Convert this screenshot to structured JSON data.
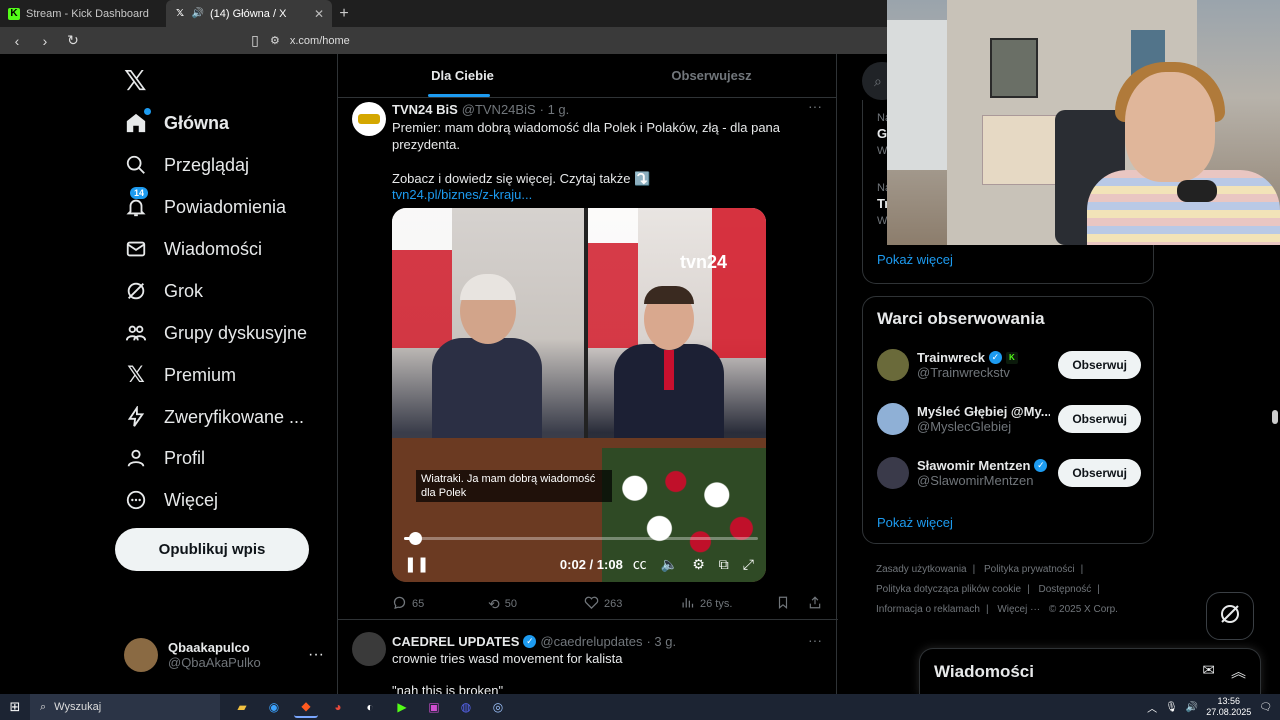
{
  "browser": {
    "tabs": [
      {
        "title": "Stream - Kick Dashboard",
        "icon": "kick-icon",
        "active": false
      },
      {
        "title": "(14) Główna / X",
        "icon": "x-icon",
        "active": true
      }
    ],
    "url": "x.com/home"
  },
  "sidebar": {
    "items": [
      {
        "label": "Główna",
        "icon": "home-icon"
      },
      {
        "label": "Przeglądaj",
        "icon": "search-icon"
      },
      {
        "label": "Powiadomienia",
        "icon": "bell-icon",
        "badge": "14"
      },
      {
        "label": "Wiadomości",
        "icon": "mail-icon"
      },
      {
        "label": "Grok",
        "icon": "grok-icon"
      },
      {
        "label": "Grupy dyskusyjne",
        "icon": "communities-icon"
      },
      {
        "label": "Premium",
        "icon": "x-icon"
      },
      {
        "label": "Zweryfikowane ...",
        "icon": "lightning-icon"
      },
      {
        "label": "Profil",
        "icon": "user-icon"
      },
      {
        "label": "Więcej",
        "icon": "more-circle-icon"
      }
    ],
    "post_button": "Opublikuj wpis",
    "account": {
      "name": "Qbaakapulco",
      "handle": "@QbaAkaPulko"
    }
  },
  "feed": {
    "tabs": [
      "Dla Ciebie",
      "Obserwujesz"
    ],
    "tweets": [
      {
        "author": "TVN24 BiS",
        "handle": "@TVN24BiS",
        "time": "· 1 g.",
        "text": "Premier: mam dobrą wiadomość dla Polek i Polaków, złą - dla pana prezydenta.",
        "text2": "Zobacz i dowiedz się więcej. Czytaj także ⤵️",
        "link": "tvn24.pl/biznes/z-kraju...",
        "video": {
          "channel_logo": "tvn24",
          "caption": "Wiatraki. Ja mam dobrą wiadomość dla Polek",
          "timecode": "0:02 / 1:08",
          "progress": 0.03
        },
        "stats": {
          "replies": "65",
          "reposts": "50",
          "likes": "263",
          "views": "26 tys."
        }
      },
      {
        "author": "CAEDREL UPDATES",
        "handle": "@caedrelupdates",
        "time": "· 3 g.",
        "text": "crownie tries wasd movement for kalista",
        "text2": "\"nah this is broken\""
      }
    ]
  },
  "right": {
    "trends_show_more": "Pokaż więcej",
    "trends": [
      {
        "cat": "Na",
        "title": "Go",
        "sub": "W"
      },
      {
        "cat": "Na",
        "title": "Tr",
        "sub": "W"
      }
    ],
    "follow_title": "Warci obserwowania",
    "follow": [
      {
        "name": "Trainwreck",
        "handle": "@Trainwreckstv",
        "verified": true,
        "kick": true,
        "avatar_color": "#6a6a3a"
      },
      {
        "name": "Myśleć Głębiej @My...",
        "handle": "@MyslecGlebiej",
        "verified": false,
        "kick": false,
        "avatar_color": "#8fb0d6"
      },
      {
        "name": "Sławomir Mentzen",
        "handle": "@SlawomirMentzen",
        "verified": true,
        "kick": false,
        "avatar_color": "#3a3a4a"
      }
    ],
    "follow_button": "Obserwuj",
    "follow_show_more": "Pokaż więcej",
    "footer": [
      "Zasady użytkowania",
      "Polityka prywatności",
      "Polityka dotycząca plików cookie",
      "Dostępność",
      "Informacja o reklamach",
      "Więcej ···",
      "© 2025 X Corp."
    ]
  },
  "messages": {
    "title": "Wiadomości"
  },
  "taskbar": {
    "search_placeholder": "Wyszukaj",
    "time": "13:56",
    "date": "27.08.2025"
  },
  "colors": {
    "accent": "#1d9bf0",
    "background": "#000000",
    "border": "#2f3336"
  }
}
